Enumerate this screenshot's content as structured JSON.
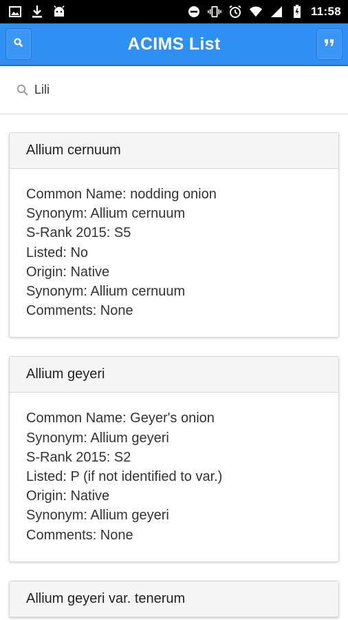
{
  "status_bar": {
    "time": "11:58",
    "left_icons": [
      "image-icon",
      "download-icon",
      "android-icon"
    ],
    "right_icons": [
      "do-not-disturb-icon",
      "vibrate-icon",
      "alarm-icon",
      "wifi-icon",
      "signal-icon",
      "battery-icon"
    ]
  },
  "app_bar": {
    "title": "ACIMS List",
    "color": "#2f8ff3",
    "left_icon": "search-icon",
    "right_icon": "quote-icon"
  },
  "search": {
    "value": "Lili",
    "icon": "search-icon"
  },
  "cards": [
    {
      "title": "Allium cernuum",
      "lines": [
        "Common Name: nodding onion",
        "Synonym: Allium cernuum",
        "S-Rank 2015: S5",
        "Listed: No",
        "Origin: Native",
        "Synonym: Allium cernuum",
        "Comments: None"
      ]
    },
    {
      "title": "Allium geyeri",
      "lines": [
        "Common Name: Geyer's onion",
        "Synonym: Allium geyeri",
        "S-Rank 2015: S2",
        "Listed: P (if not identified to var.)",
        "Origin: Native",
        "Synonym: Allium geyeri",
        "Comments: None"
      ]
    },
    {
      "title": "Allium geyeri var. tenerum",
      "lines": []
    }
  ]
}
